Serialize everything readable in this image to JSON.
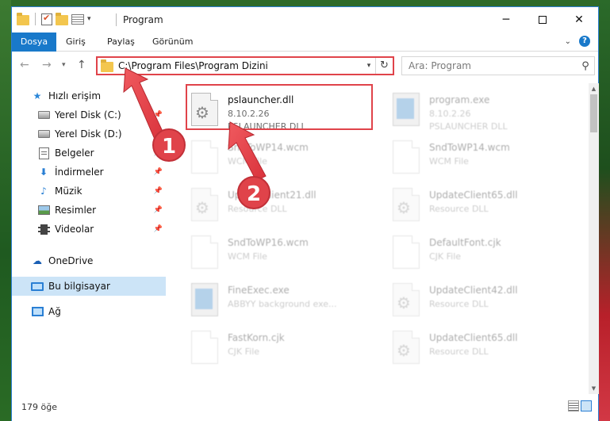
{
  "window": {
    "title": "Program"
  },
  "ribbon": {
    "tabs": [
      "Dosya",
      "Giriş",
      "Paylaş",
      "Görünüm"
    ]
  },
  "address": {
    "path": "C:\\Program Files\\Program Dizini"
  },
  "search": {
    "placeholder": "Ara: Program"
  },
  "sidebar": {
    "items": [
      {
        "label": "Hızlı erişim",
        "icon": "star-icon",
        "pinned": false
      },
      {
        "label": "Yerel Disk (C:)",
        "icon": "drive-icon",
        "pinned": true
      },
      {
        "label": "Yerel Disk (D:)",
        "icon": "drive-icon",
        "pinned": true
      },
      {
        "label": "Belgeler",
        "icon": "documents-icon",
        "pinned": true
      },
      {
        "label": "İndirmeler",
        "icon": "downloads-icon",
        "pinned": true
      },
      {
        "label": "Müzik",
        "icon": "music-icon",
        "pinned": true
      },
      {
        "label": "Resimler",
        "icon": "pictures-icon",
        "pinned": true
      },
      {
        "label": "Videolar",
        "icon": "videos-icon",
        "pinned": true
      },
      {
        "label": "OneDrive",
        "icon": "onedrive-icon",
        "pinned": false
      },
      {
        "label": "Bu bilgisayar",
        "icon": "computer-icon",
        "pinned": false,
        "selected": true
      },
      {
        "label": "Ağ",
        "icon": "network-icon",
        "pinned": false
      }
    ]
  },
  "files": [
    {
      "name": "pslauncher.dll",
      "version": "8.10.2.26",
      "desc": "PSLAUNCHER DLL",
      "icon": "dll-file-icon",
      "highlighted": true
    },
    {
      "name": "program.exe",
      "version": "8.10.2.26",
      "desc": "PSLAUNCHER DLL",
      "icon": "exe-file-icon"
    },
    {
      "name": "SndToWP14.wcm",
      "version": "",
      "desc": "WCM File",
      "icon": "blank-file-icon"
    },
    {
      "name": "SndToWP14.wcm",
      "version": "",
      "desc": "WCM File",
      "icon": "blank-file-icon"
    },
    {
      "name": "UpdateClient21.dll",
      "version": "",
      "desc": "Resource DLL",
      "icon": "dll-file-icon"
    },
    {
      "name": "UpdateClient65.dll",
      "version": "",
      "desc": "Resource DLL",
      "icon": "dll-file-icon"
    },
    {
      "name": "SndToWP16.wcm",
      "version": "",
      "desc": "WCM File",
      "icon": "blank-file-icon"
    },
    {
      "name": "DefaultFont.cjk",
      "version": "",
      "desc": "CJK File",
      "icon": "blank-file-icon"
    },
    {
      "name": "FineExec.exe",
      "version": "",
      "desc": "ABBYY background exe...",
      "icon": "exe-file-icon"
    },
    {
      "name": "UpdateClient42.dll",
      "version": "",
      "desc": "Resource DLL",
      "icon": "dll-file-icon"
    },
    {
      "name": "FastKorn.cjk",
      "version": "",
      "desc": "CJK File",
      "icon": "blank-file-icon"
    },
    {
      "name": "UpdateClient65.dll",
      "version": "",
      "desc": "Resource DLL",
      "icon": "dll-file-icon"
    }
  ],
  "status": {
    "item_count": "179 öğe"
  },
  "annotations": {
    "badge1": "1",
    "badge2": "2"
  },
  "colors": {
    "accent": "#1979ca",
    "highlight": "#e0434a",
    "selected": "#cce4f7"
  }
}
